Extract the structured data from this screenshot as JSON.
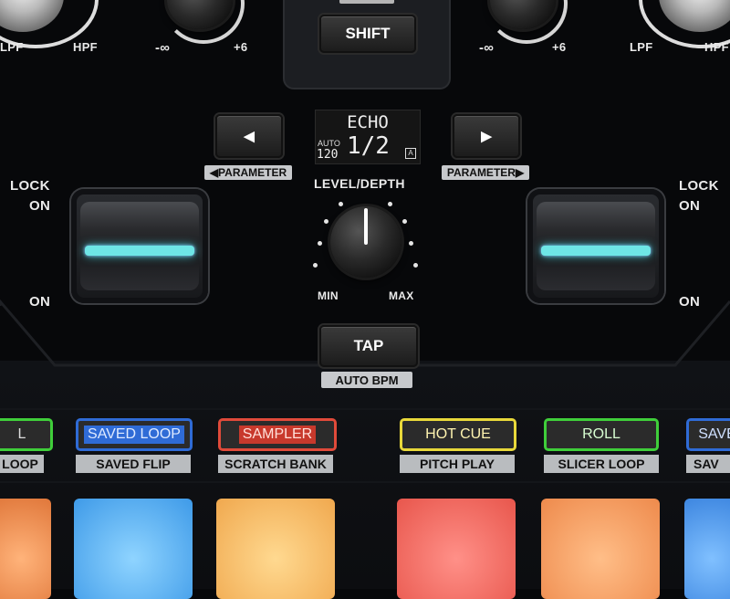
{
  "top": {
    "left_filter": {
      "lpf": "LPF",
      "hpf": "HPF"
    },
    "right_filter": {
      "lpf": "LPF",
      "hpf": "HPF"
    },
    "left_trim": {
      "min": "-∞",
      "max": "+6"
    },
    "right_trim": {
      "min": "-∞",
      "max": "+6"
    },
    "shift_label": "SHIFT"
  },
  "fx": {
    "display": {
      "effect": "ECHO",
      "mode": "AUTO",
      "bpm": "120",
      "beat": "1/2",
      "badge": "A"
    },
    "param_left_tag": "◀PARAMETER",
    "param_right_tag": "PARAMETER▶",
    "level_depth_label": "LEVEL/DEPTH",
    "knob_min": "MIN",
    "knob_max": "MAX",
    "tap_label": "TAP",
    "auto_bpm_tag": "AUTO BPM",
    "level_depth_value": 0.5
  },
  "left_lever": {
    "lock_label": "LOCK",
    "on_top_label": "ON",
    "on_bottom_label": "ON"
  },
  "right_lever": {
    "lock_label": "LOCK",
    "on_top_label": "ON",
    "on_bottom_label": "ON"
  },
  "pad_modes": [
    {
      "label": "L",
      "sub": "LOOP",
      "color": "#3fce3a"
    },
    {
      "label": "SAVED LOOP",
      "sub": "SAVED FLIP",
      "color": "#2f6bd6"
    },
    {
      "label": "SAMPLER",
      "sub": "SCRATCH BANK",
      "color": "#e04a3a"
    },
    {
      "label": "HOT CUE",
      "sub": "PITCH PLAY",
      "color": "#e8d83a"
    },
    {
      "label": "ROLL",
      "sub": "SLICER LOOP",
      "color": "#3fce3a"
    },
    {
      "label": "SAVE",
      "sub": "SAV",
      "color": "#2f6bd6"
    }
  ],
  "pad_colors": [
    "#f09a5a",
    "#5ab8f5",
    "#f5c06a",
    "#f2726a",
    "#f3a066",
    "#5aa0f0"
  ],
  "colors": {
    "lever_led": "#6ee6e6",
    "tag_bg": "#c7c9cc"
  }
}
